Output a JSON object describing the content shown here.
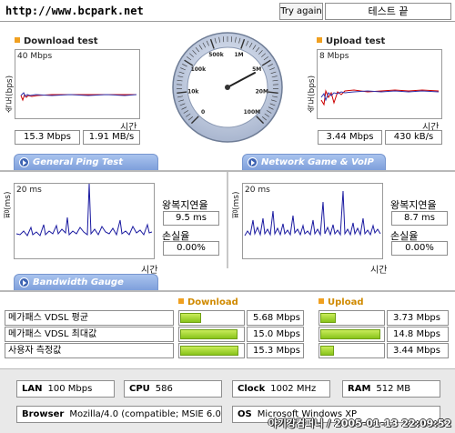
{
  "header": {
    "site_url": "http://www.bcpark.net",
    "try_again_label": "Try again",
    "status_label": "테스트 끝"
  },
  "download": {
    "title": "Download test",
    "axis_label": "속도(bps)",
    "scale_label": "40 Mbps",
    "time_label": "시간",
    "mbps": "15.3 Mbps",
    "mbytes": "1.91 MB/s"
  },
  "upload": {
    "title": "Upload test",
    "axis_label": "속도(bps)",
    "scale_label": "8 Mbps",
    "time_label": "시간",
    "mbps": "3.44 Mbps",
    "kbytes": "430 kB/s"
  },
  "gauge": {
    "tick_labels": [
      "0",
      "10k",
      "100k",
      "500k",
      "1M",
      "5M",
      "20M",
      "100M"
    ],
    "needle_value_label": "15.3 Mbps"
  },
  "ping": {
    "tab_label": "General Ping Test",
    "axis_label": "핑(ms)",
    "scale_label": "20 ms",
    "rtt_label": "왕복지연율",
    "rtt_value": "9.5 ms",
    "loss_label": "손실율",
    "loss_value": "0.00%",
    "time_label": "시간"
  },
  "game": {
    "tab_label": "Network Game & VoIP Test",
    "axis_label": "핑(ms)",
    "scale_label": "20 ms",
    "rtt_label": "왕복지연율",
    "rtt_value": "8.7 ms",
    "loss_label": "손실율",
    "loss_value": "0.00%",
    "time_label": "시간"
  },
  "bandwidth": {
    "tab_label": "Bandwidth Gauge",
    "download_header": "Download",
    "upload_header": "Upload",
    "rows": [
      {
        "label": "메가패스 VDSL 평균",
        "down": "5.68 Mbps",
        "down_fraction": 0.34,
        "up": "3.73 Mbps",
        "up_fraction": 0.24
      },
      {
        "label": "메가패스 VDSL 최대값",
        "down": "15.0 Mbps",
        "down_fraction": 0.91,
        "up": "14.8 Mbps",
        "up_fraction": 0.95
      },
      {
        "label": "사용자 측정값",
        "down": "15.3 Mbps",
        "down_fraction": 0.93,
        "up": "3.44 Mbps",
        "up_fraction": 0.22
      }
    ]
  },
  "system": {
    "lan_label": "LAN",
    "lan_value": "100 Mbps",
    "cpu_label": "CPU",
    "cpu_value": "586",
    "clock_label": "Clock",
    "clock_value": "1002 MHz",
    "ram_label": "RAM",
    "ram_value": "512 MB",
    "browser_label": "Browser",
    "browser_value": "Mozilla/4.0 (compatible; MSIE 6.0",
    "os_label": "OS",
    "os_value": "Microsoft Windows XP"
  },
  "watermark": "야기강컴퍼니 / 2005-01-13 22:09:52",
  "colors": {
    "accent_orange": "#f0a020",
    "tab_blue": "#7e9fdb",
    "bar_green": "#88c41a",
    "ping_line": "#1a1aa0",
    "speed_line_red": "#cc0000",
    "speed_line_blue": "#3333aa"
  }
}
